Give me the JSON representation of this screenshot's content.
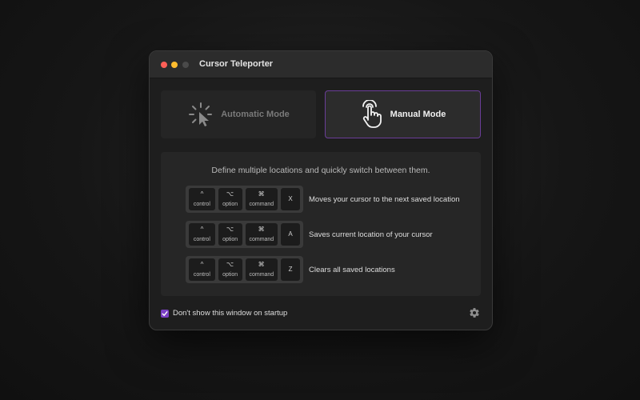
{
  "window": {
    "title": "Cursor Teleporter"
  },
  "modes": {
    "automatic": {
      "label": "Automatic Mode",
      "icon": "sparkle-cursor-icon",
      "selected": false
    },
    "manual": {
      "label": "Manual Mode",
      "icon": "pointing-hand-icon",
      "selected": true
    }
  },
  "panel": {
    "description": "Define multiple locations and quickly switch between them.",
    "shortcuts": [
      {
        "keys": [
          {
            "symbol": "^",
            "name": "control"
          },
          {
            "symbol": "⌥",
            "name": "option"
          },
          {
            "symbol": "⌘",
            "name": "command"
          },
          {
            "letter": "X"
          }
        ],
        "description": "Moves your cursor to the next saved location"
      },
      {
        "keys": [
          {
            "symbol": "^",
            "name": "control"
          },
          {
            "symbol": "⌥",
            "name": "option"
          },
          {
            "symbol": "⌘",
            "name": "command"
          },
          {
            "letter": "A"
          }
        ],
        "description": "Saves current location of your cursor"
      },
      {
        "keys": [
          {
            "symbol": "^",
            "name": "control"
          },
          {
            "symbol": "⌥",
            "name": "option"
          },
          {
            "symbol": "⌘",
            "name": "command"
          },
          {
            "letter": "Z"
          }
        ],
        "description": "Clears all saved locations"
      }
    ]
  },
  "footer": {
    "startup_checkbox": {
      "label": "Don't show this window on startup",
      "checked": true
    },
    "settings_icon": "gear-icon"
  },
  "colors": {
    "accent": "#7b3fc4",
    "selected_border": "#6a3d97",
    "close": "#fe5f57",
    "minimize": "#febc2e",
    "maximize": "#4a4a4a"
  }
}
